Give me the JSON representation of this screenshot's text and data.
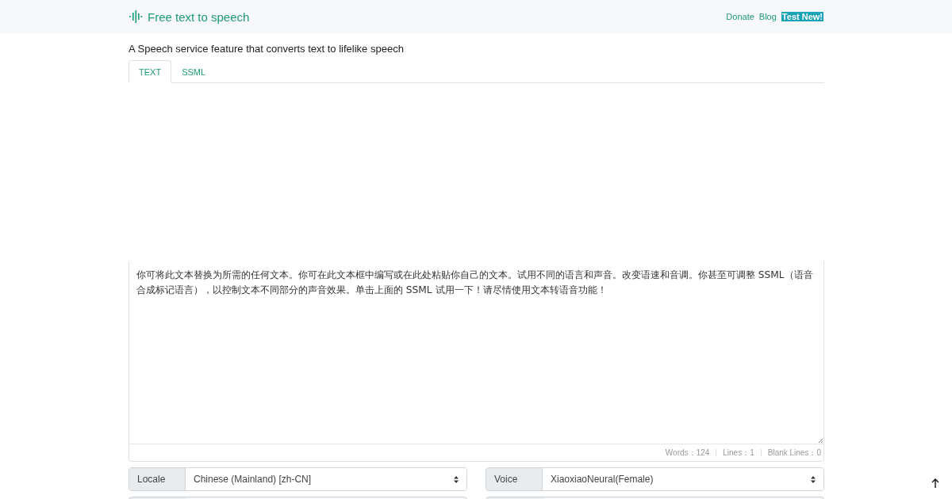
{
  "header": {
    "brand": "Free text to speech",
    "links": [
      {
        "label": "Donate",
        "kind": "link"
      },
      {
        "label": "Blog",
        "kind": "link"
      },
      {
        "label": "Test New!",
        "kind": "highlight"
      }
    ]
  },
  "subtitle": "A Speech service feature that converts text to lifelike speech",
  "tabs": [
    {
      "label": "TEXT",
      "selected": true
    },
    {
      "label": "SSML",
      "selected": false
    }
  ],
  "editor": {
    "text": "你可将此文本替换为所需的任何文本。你可在此文本框中编写或在此处粘贴你自己的文本。试用不同的语言和声音。改变语速和音调。你甚至可调整 SSML（语音合成标记语言），以控制文本不同部分的声音效果。单击上面的 SSML 试用一下！请尽情使用文本转语音功能！",
    "stats": [
      "Words：124",
      "Lines：1",
      "Blank Lines：0"
    ]
  },
  "controls": [
    {
      "kind": "select",
      "label": "Locale",
      "value": "Chinese (Mainland) [zh-CN]"
    },
    {
      "kind": "select",
      "label": "Voice",
      "value": "XiaoxiaoNeural(Female)"
    },
    {
      "kind": "edge"
    },
    {
      "kind": "edge"
    }
  ]
}
